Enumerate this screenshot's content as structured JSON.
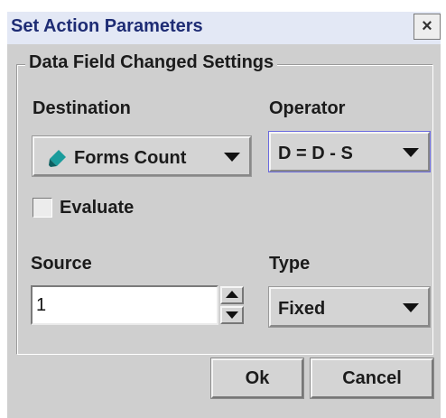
{
  "dialog": {
    "title": "Set Action Parameters",
    "close_symbol": "×"
  },
  "group": {
    "legend": "Data Field Changed Settings"
  },
  "destination": {
    "label": "Destination",
    "value": "Forms Count",
    "icon": "pencil-icon"
  },
  "operator": {
    "label": "Operator",
    "value": "D = D - S"
  },
  "evaluate": {
    "label": "Evaluate",
    "checked": false
  },
  "source": {
    "label": "Source",
    "value": "1"
  },
  "type": {
    "label": "Type",
    "value": "Fixed"
  },
  "buttons": {
    "ok": "Ok",
    "cancel": "Cancel"
  },
  "colors": {
    "title_text": "#1e2c74",
    "title_bar": "#e3e8f5",
    "panel": "#cfcfcf",
    "pencil": "#1a9c9c"
  }
}
